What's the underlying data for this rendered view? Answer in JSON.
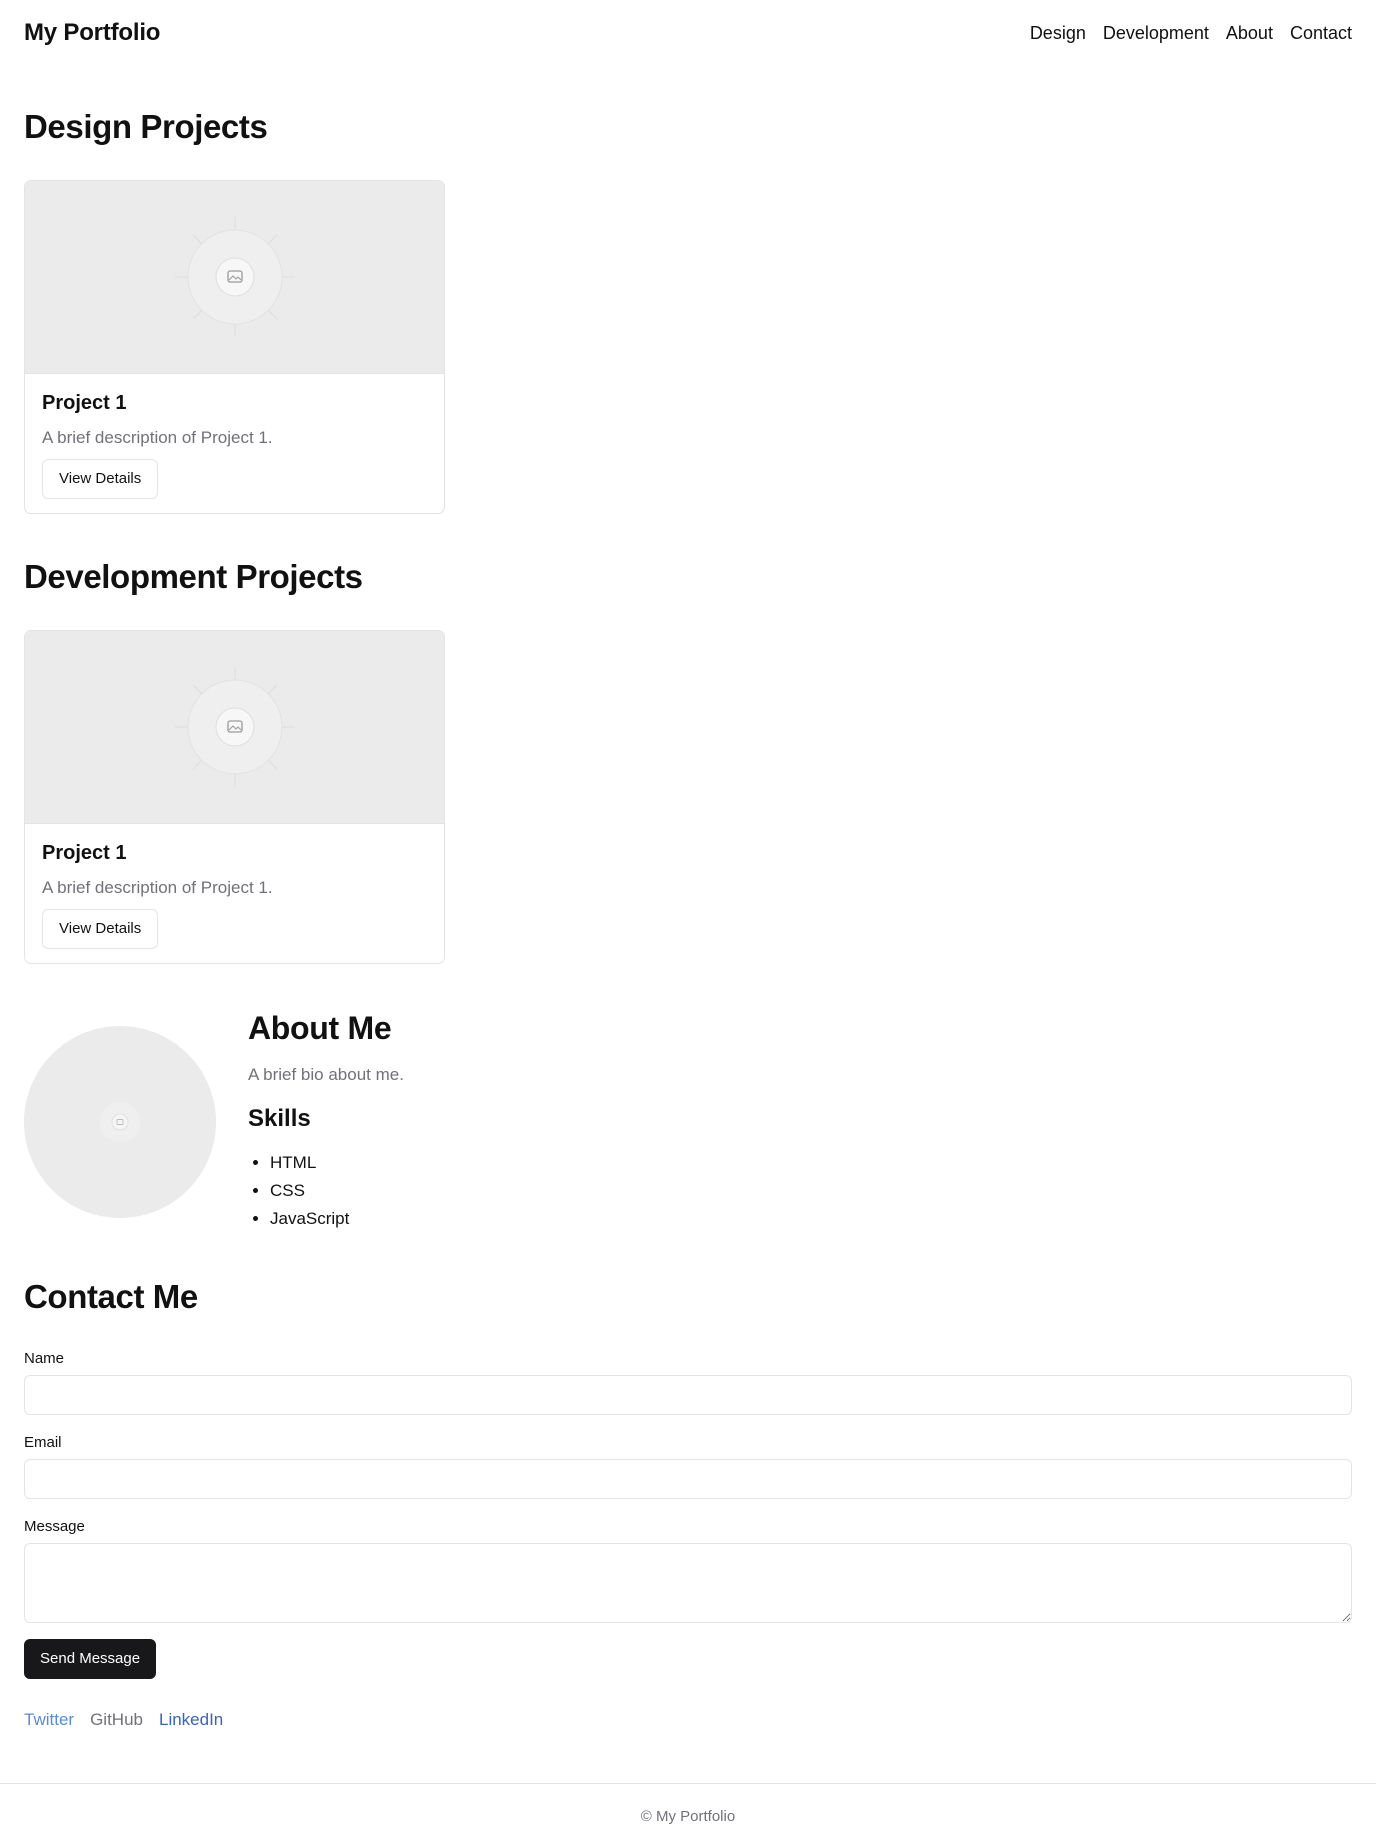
{
  "header": {
    "logo": "My Portfolio",
    "nav": [
      "Design",
      "Development",
      "About",
      "Contact"
    ]
  },
  "design": {
    "title": "Design Projects",
    "project": {
      "title": "Project 1",
      "description": "A brief description of Project 1.",
      "button": "View Details"
    }
  },
  "development": {
    "title": "Development Projects",
    "project": {
      "title": "Project 1",
      "description": "A brief description of Project 1.",
      "button": "View Details"
    }
  },
  "about": {
    "title": "About Me",
    "bio": "A brief bio about me.",
    "skills_title": "Skills",
    "skills": [
      "HTML",
      "CSS",
      "JavaScript"
    ]
  },
  "contact": {
    "title": "Contact Me",
    "name_label": "Name",
    "email_label": "Email",
    "message_label": "Message",
    "submit": "Send Message"
  },
  "social": {
    "links": [
      "Twitter",
      "GitHub",
      "LinkedIn"
    ],
    "colors": [
      "#5b8bd4",
      "#71717a",
      "#3b63b8"
    ]
  },
  "footer": {
    "text": "© My Portfolio"
  },
  "icons": {
    "placeholder": "image-placeholder-icon"
  }
}
